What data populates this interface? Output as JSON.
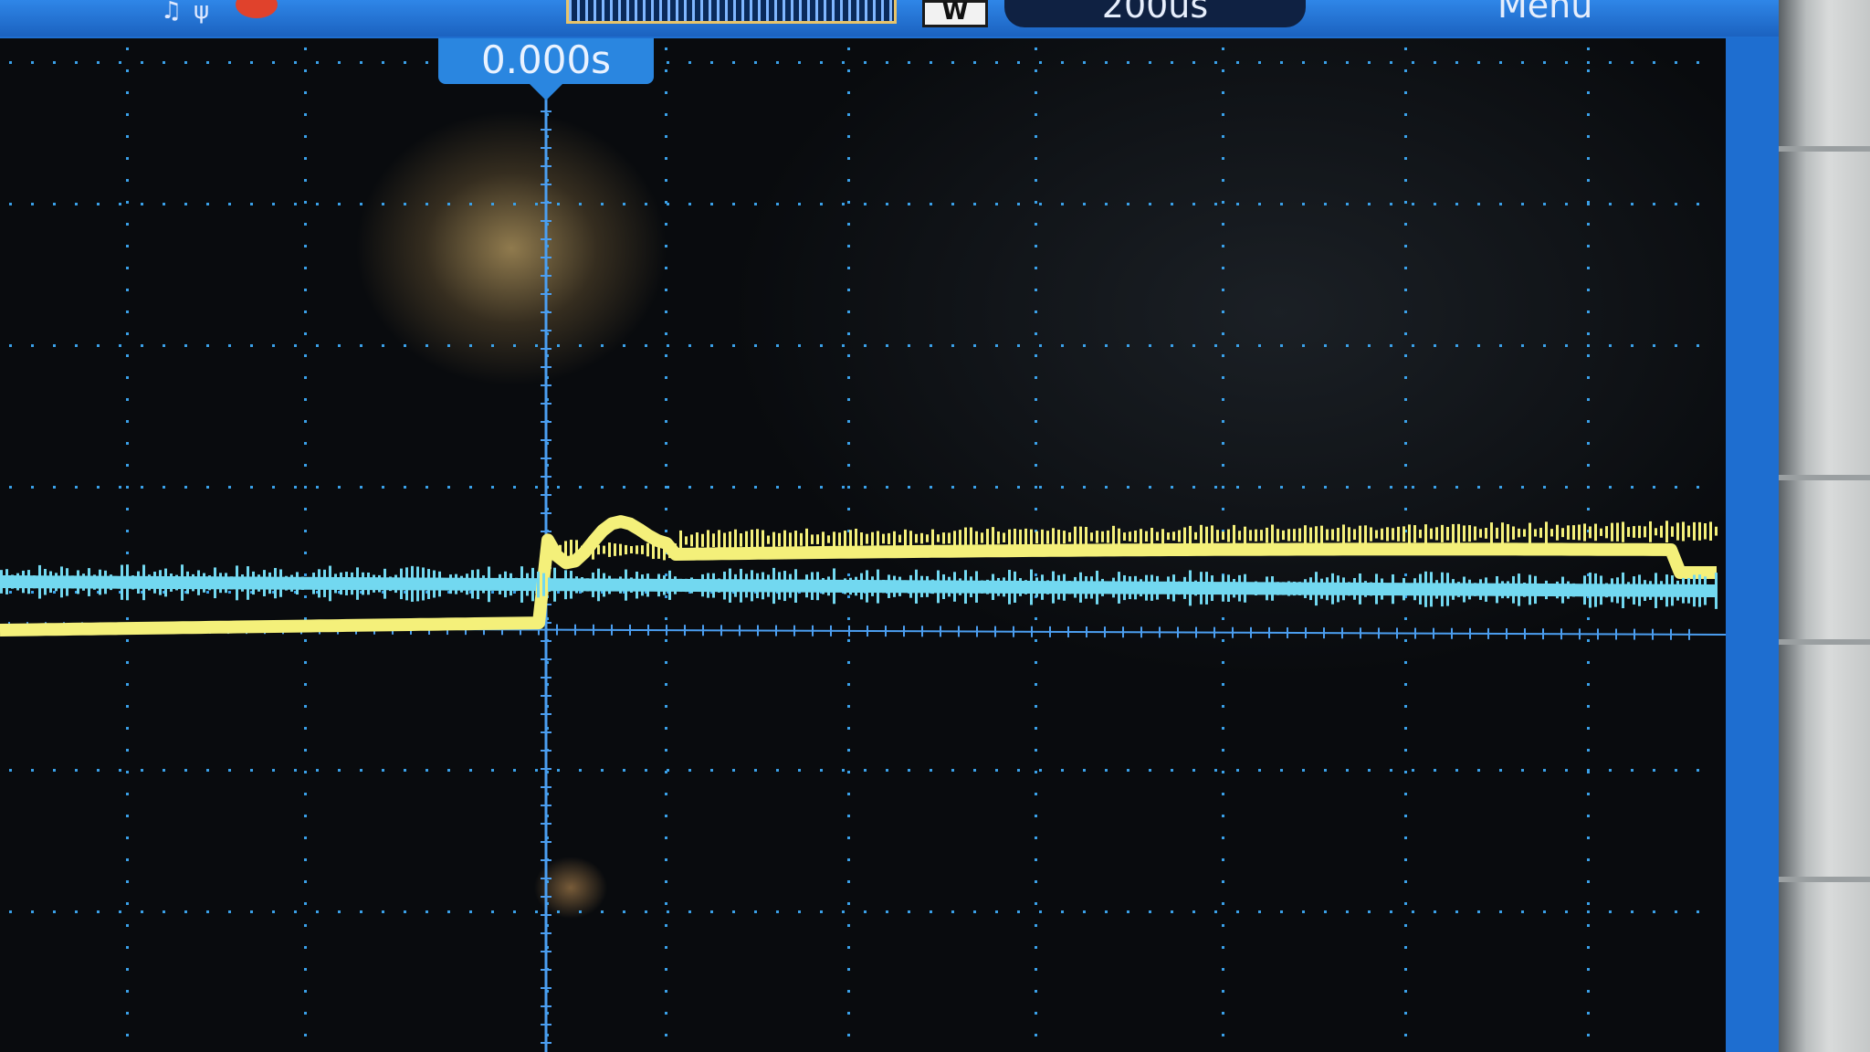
{
  "topbar": {
    "timebase": "200us",
    "menu_label": "Menu",
    "mode_glyph": "W"
  },
  "screen": {
    "trigger_time": "0.000s"
  },
  "colors": {
    "frame": "#1f6fd0",
    "ch1_trace": "#f4f07a",
    "ch2_trace": "#72d8f0",
    "grid": "#3aa0e8",
    "record_indicator": "#e0422c"
  },
  "icons": [
    "probe-icon",
    "antenna-icon",
    "record-dot-icon",
    "memory-bar-icon"
  ]
}
